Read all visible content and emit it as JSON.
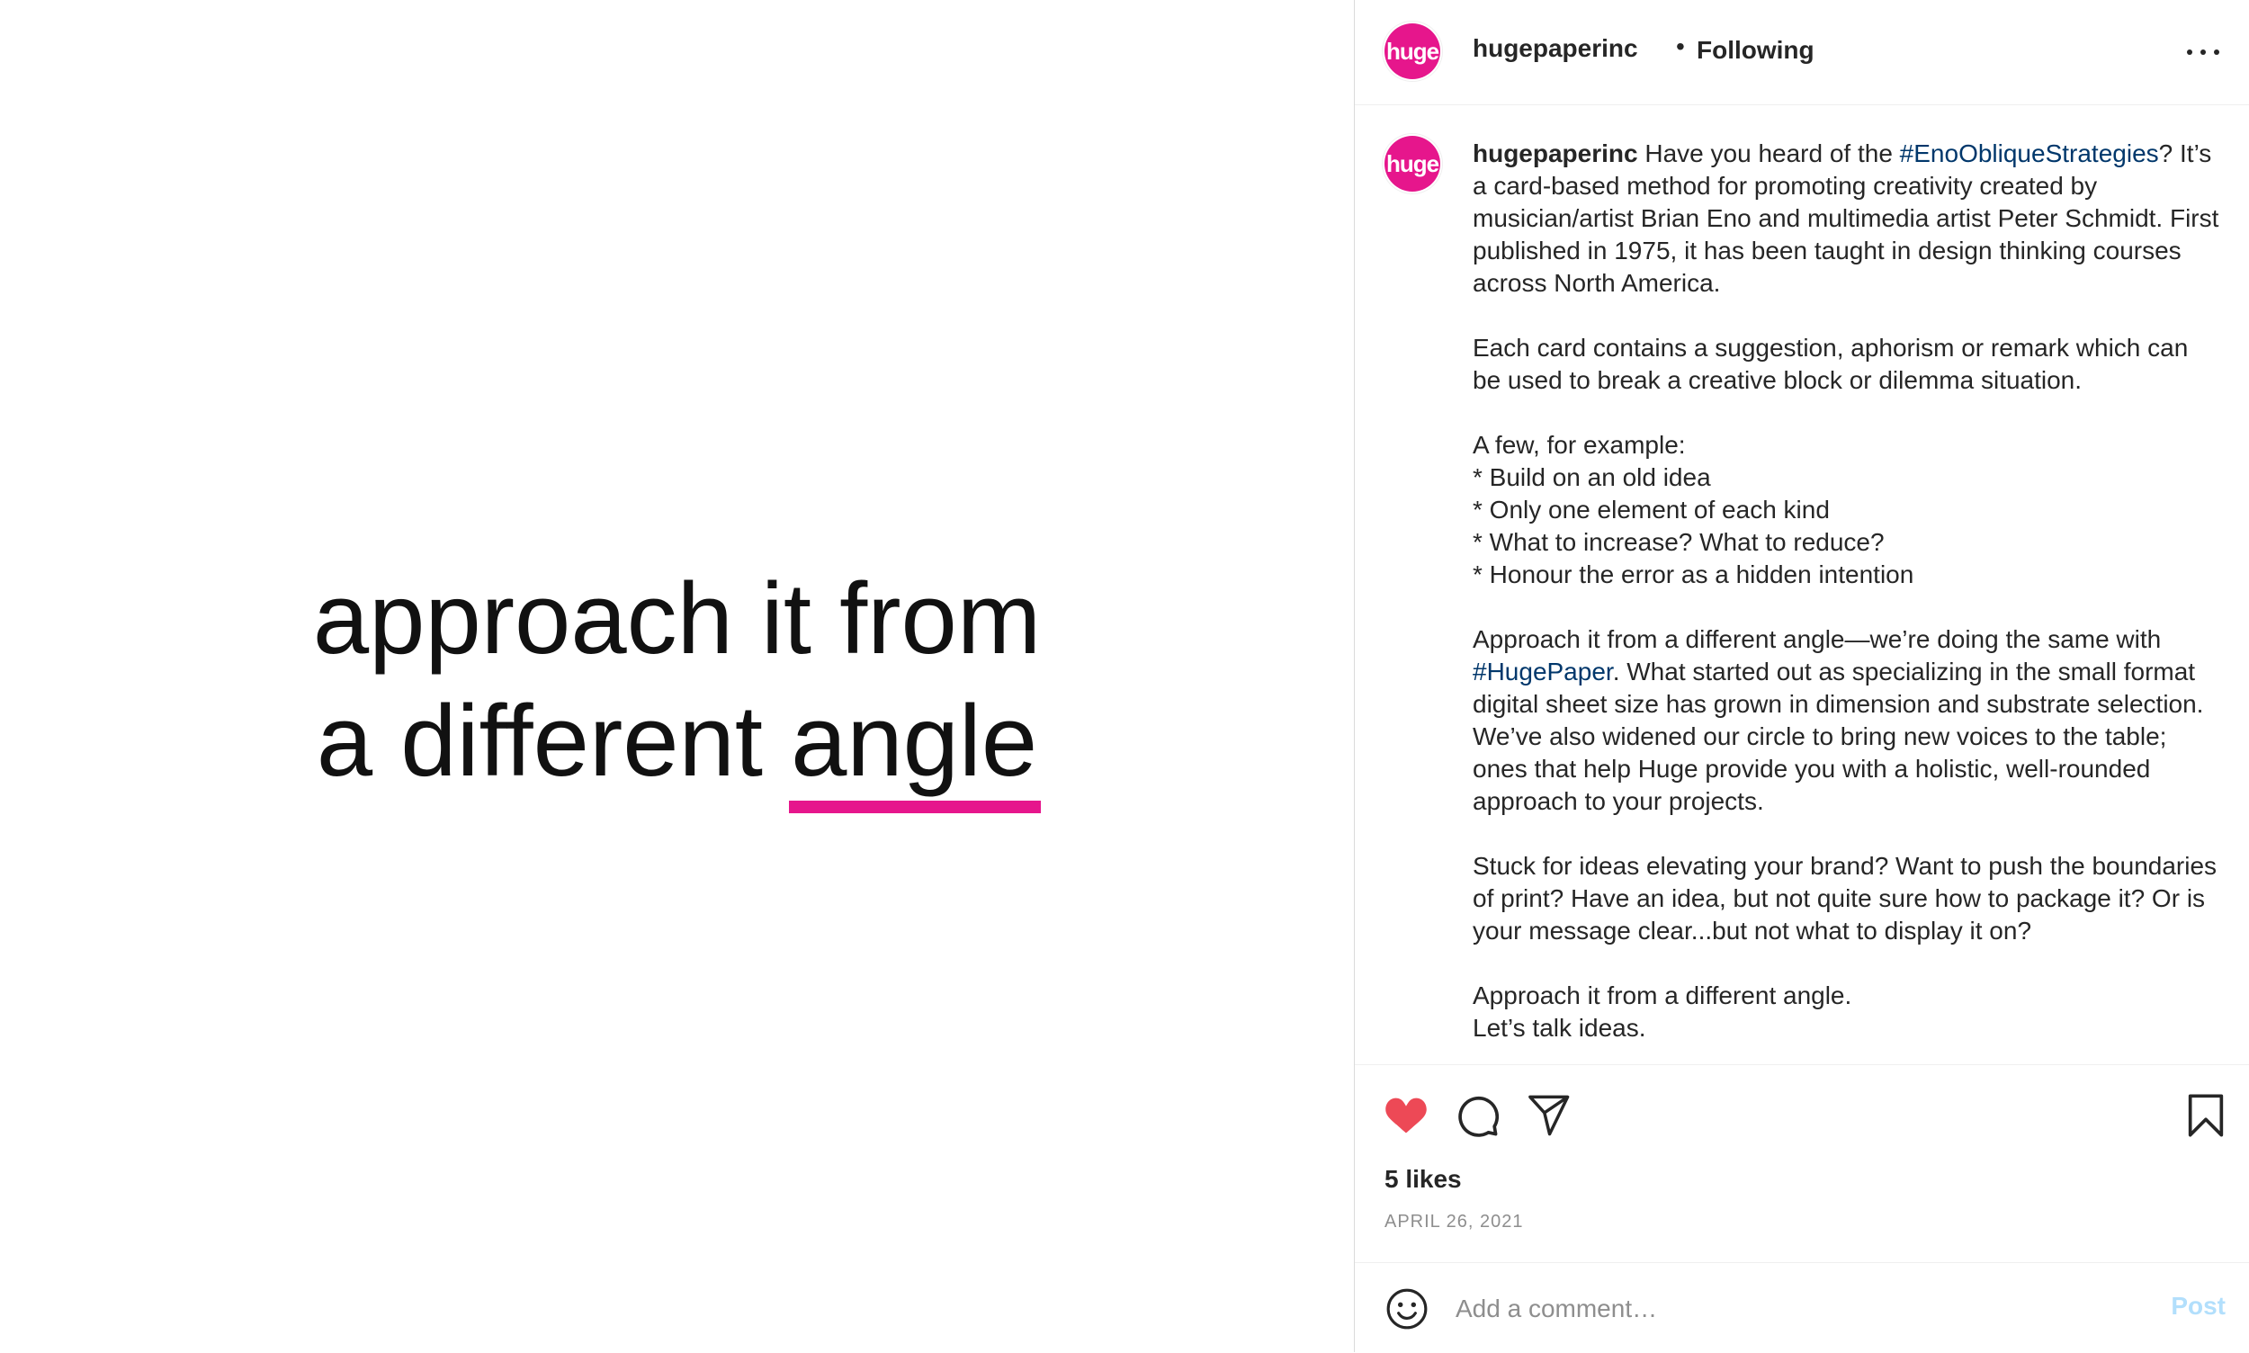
{
  "media": {
    "line1": "approach it from",
    "line2_prefix": "a different ",
    "line2_emphasis": "angle",
    "underline_color": "#e6168c"
  },
  "header": {
    "avatar_text": "huge",
    "username": "hugepaperinc",
    "separator": "•",
    "follow_status": "Following",
    "more_icon": "more-horizontal-icon"
  },
  "caption": {
    "username": "hugepaperinc",
    "avatar_text": "huge",
    "p1_a": " Have you heard of the ",
    "p1_tag": "#EnoObliqueStrategies",
    "p1_b": "? It’s a card-based method for promoting creativity created by musician/artist Brian Eno and multimedia artist Peter Schmidt. First published in 1975, it has been taught in design thinking courses across North America.\n\nEach card contains a suggestion, aphorism or remark which can be used to break a creative block or dilemma situation.\n\nA few, for example:\n* Build on an old idea\n* Only one element of each kind\n* What to increase? What to reduce?\n* Honour the error as a hidden intention\n\nApproach it from a different angle—we’re doing the same with ",
    "p2_tag": "#HugePaper",
    "p2_b": ". What started out as specializing in the small format digital sheet size has grown in dimension and substrate selection. We’ve also widened our circle to bring new voices to the table; ones that help Huge provide you with a holistic, well-rounded approach to your projects.\n\nStuck for ideas elevating your brand? Want to push the boundaries of print? Have an idea, but not quite sure how to package it? Or is your message clear...but not what to display it on?\n\nApproach it from a different angle.\nLet’s talk ideas."
  },
  "actions": {
    "like_icon": "heart-filled-icon",
    "like_color": "#ed4956",
    "comment_icon": "comment-icon",
    "share_icon": "paper-plane-icon",
    "save_icon": "bookmark-icon",
    "likes": "5 likes",
    "date": "APRIL 26, 2021"
  },
  "add_comment": {
    "emoji_icon": "emoji-smile-icon",
    "placeholder": "Add a comment…",
    "post_label": "Post",
    "post_color": "#b2dffc"
  }
}
